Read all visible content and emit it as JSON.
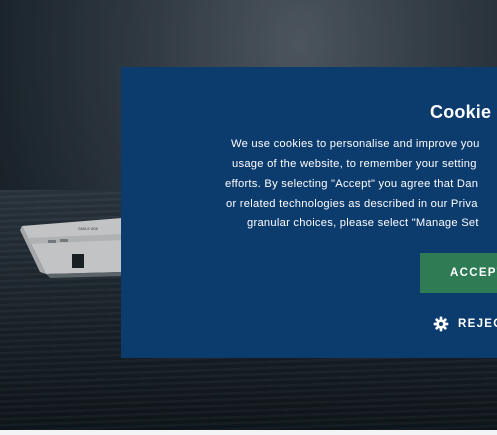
{
  "cookie_dialog": {
    "title": "Cookie",
    "description_lines": [
      "We use cookies to personalise and improve you",
      "usage of the website, to remember your setting",
      "efforts. By selecting \"Accept\" you agree that Dan",
      "or related technologies as described in our Priva",
      "granular choices, please select \"Manage Set"
    ],
    "accept_label": "ACCEPT",
    "reject_label": "REJEC",
    "reject_icon": "gear-icon",
    "colors": {
      "dialog_bg": "#0c3b6e",
      "accept_bg": "#2e7b54",
      "text": "#ffffff"
    }
  },
  "background": {
    "ship_label": "SMILE 808"
  }
}
